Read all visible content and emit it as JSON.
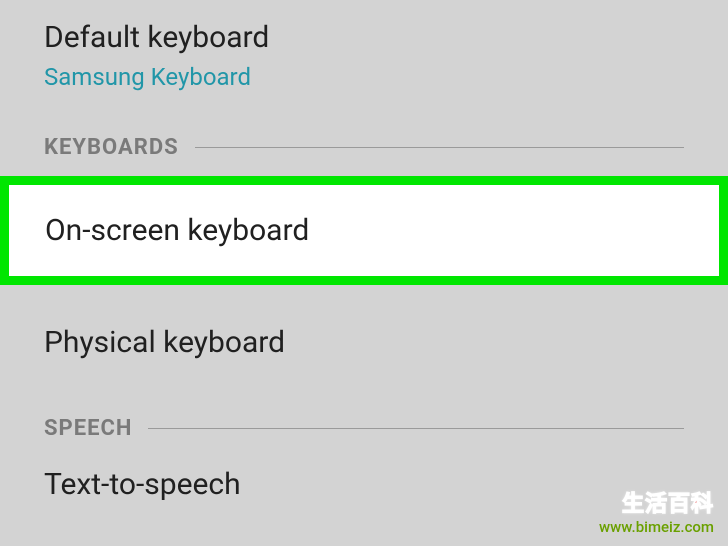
{
  "default_keyboard": {
    "title": "Default keyboard",
    "value": "Samsung Keyboard"
  },
  "sections": {
    "keyboards": {
      "header": "KEYBOARDS",
      "items": {
        "onscreen": "On-screen keyboard",
        "physical": "Physical keyboard"
      }
    },
    "speech": {
      "header": "SPEECH",
      "items": {
        "tts": "Text-to-speech"
      }
    }
  },
  "watermark": {
    "line1": "生活百科",
    "line2": "www.bimeiz.com"
  }
}
